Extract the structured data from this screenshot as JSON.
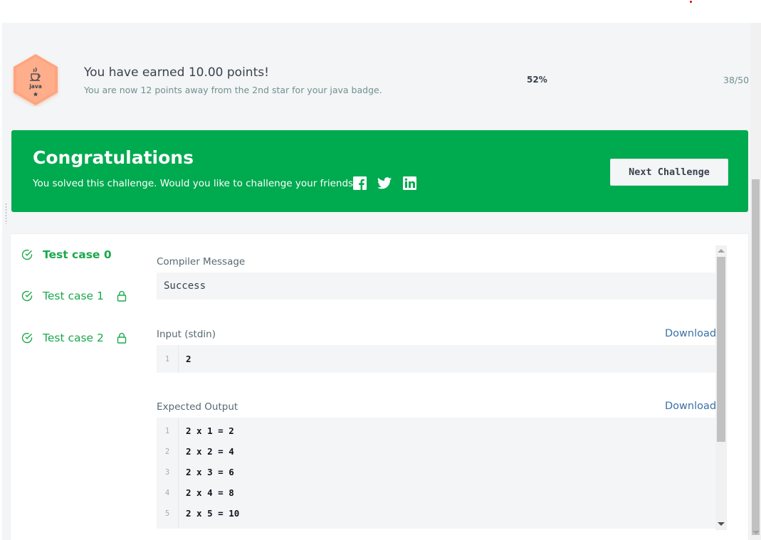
{
  "points_banner": {
    "badge_label": "java",
    "title": "You have earned 10.00 points!",
    "subtitle": "You are now 12 points away from the 2nd star for your java badge.",
    "percent_label": "52%",
    "progress": 0.52,
    "progress_count": "38/50"
  },
  "congrats": {
    "title": "Congratulations",
    "message": "You solved this challenge. Would you like to challenge your friends?",
    "next_label": "Next Challenge",
    "social_icons": [
      "facebook-icon",
      "twitter-icon",
      "linkedin-icon"
    ],
    "background": "#00aa4f"
  },
  "test_cases": [
    {
      "label": "Test case 0",
      "status": "passed",
      "locked": false,
      "active": true
    },
    {
      "label": "Test case 1",
      "status": "passed",
      "locked": true,
      "active": false
    },
    {
      "label": "Test case 2",
      "status": "passed",
      "locked": true,
      "active": false
    }
  ],
  "compiler": {
    "label": "Compiler Message",
    "message": "Success"
  },
  "input": {
    "label": "Input (stdin)",
    "download_label": "Download",
    "lines": [
      {
        "num": "1",
        "text": "2"
      }
    ]
  },
  "expected_output": {
    "label": "Expected Output",
    "download_label": "Download",
    "lines": [
      {
        "num": "1",
        "text": "2 x 1 = 2"
      },
      {
        "num": "2",
        "text": "2 x 2 = 4"
      },
      {
        "num": "3",
        "text": "2 x 3 = 6"
      },
      {
        "num": "4",
        "text": "2 x 4 = 8"
      },
      {
        "num": "5",
        "text": "2 x 5 = 10"
      }
    ]
  },
  "colors": {
    "accent_green": "#1ba94c",
    "link_blue": "#3a70a6",
    "badge_orange": "#ffa47e"
  }
}
